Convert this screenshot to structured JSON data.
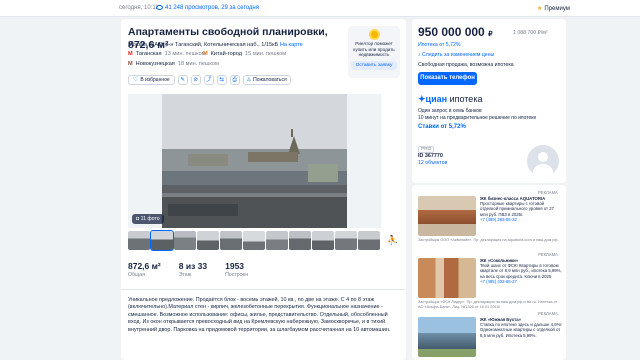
{
  "topbar": {
    "date": "сегодня, 10:11",
    "views": "41 248 просмотров, 29 за сегодня",
    "premium": "Премиум"
  },
  "listing": {
    "title": "Апартаменты свободной планировки, 872,6 м²",
    "address": "Москва, ЦАО, р-н Таганский, Котельническая наб., 1/15кБ",
    "map_link": "На карте",
    "metro": [
      {
        "station": "Таганская",
        "walk": "13 мин. пешком",
        "color": "#e42313"
      },
      {
        "station": "Китай-город",
        "walk": "15 мин. пешком",
        "color": "#f07e26"
      },
      {
        "station": "Новокузнецкая",
        "walk": "18 мин. пешком",
        "color": "#894e35"
      }
    ],
    "favorite_label": "В избранное",
    "complain_label": "Пожаловаться",
    "photo_count": "11 фото"
  },
  "realtor_badge": {
    "text": "Риелтор поможет купить или продать недвижимость",
    "button": "Оставить заявку"
  },
  "specs": [
    {
      "value": "872,6 м²",
      "label": "Общая"
    },
    {
      "value": "8 из 33",
      "label": "Этаж"
    },
    {
      "value": "1953",
      "label": "Построен"
    }
  ],
  "description": "Уникальное предложение. Продаётся блок - восемь этажей, 10 кв., по две на этаже. С 4 по 8 этаж (включительно).Материал стен - кирпич, железобетонные перекрытия. Функциональное назначение - смешанное. Возможное использование: офисы, жилье, представительство. Отдельный, обособленный вход. Из окон открывается превосходный вид на Кремлевскую набережную, Замоскворечье, и в тихий внутренний двор. Парковка на придомовой территории, за шлагбаумом рассчитанная на 10 автомашин.",
  "price_card": {
    "price": "950 000 000",
    "currency": "₽",
    "price_per_m2": "1 088 700 ₽/м²",
    "mortgage_link": "Ипотека от 5,72%",
    "follow_link": "Следить за изменением цены",
    "deal": "Свободная продажа, возможна ипотека",
    "call_button": "Показать телефон"
  },
  "cian": {
    "logo": "циан",
    "logo_sub": "ипотека",
    "line1": "Один запрос в семь банков",
    "line2": "10 минут на предварительное решение по ипотеке",
    "rate": "Ставки от 5,72%"
  },
  "agent": {
    "pro": "PRO",
    "id": "ID 367770",
    "objects": "12 объектов"
  },
  "ads": [
    {
      "tag": "РЕКЛАМА",
      "title": "ЖК бизнес-класса AQUATORIA",
      "body": "Просторные квартиры с готовой отделкой премиального уровня от 27 млн руб. ПВЗ в 2025г.",
      "phone": "+7 (499) 283-05-32",
      "foot": "Застройщик ООО «Аквилайн». Пр. декларация на aquatoria.com и наш.дом.рф"
    },
    {
      "tag": "РЕКЛАМА",
      "title": "ЖК «Сокольники»",
      "body": "Твой шанс от ФСК! Квартиры в готовом квартале от 8,9 млн руб., ипотека 5,99%, на весь срок кредита. Ключи в 2025",
      "phone": "+7 (495) 432-65-27",
      "foot": "Застройщик «ФСК Лидер». Пр. декларация на наш.дом.рф и fsk.ru. Ипотека от АО «Альфа-Банк». Лиц. №1326 от 16.01.2015г"
    },
    {
      "tag": "РЕКЛАМА",
      "title": "ЖК «Южная Бухта»",
      "body": "Ставка по ипотеке здесь и дальше 4,5%! Однокомнатные квартиры с отделкой от 6,5 млн руб. Ипотека 5,99%.",
      "phone": "",
      "foot": ""
    }
  ],
  "colors": {
    "accent": "#0468ff",
    "text": "#152242",
    "muted": "#7a7f8c",
    "background": "#f0f3f6"
  }
}
